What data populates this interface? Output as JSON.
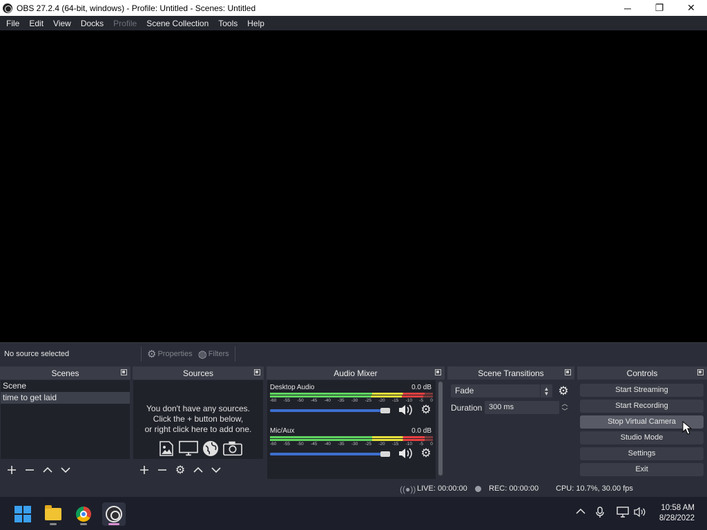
{
  "window": {
    "title": "OBS 27.2.4 (64-bit, windows) - Profile: Untitled - Scenes: Untitled",
    "minimize": "─",
    "maximize": "❐",
    "close": "✕"
  },
  "menu": [
    "File",
    "Edit",
    "View",
    "Docks",
    "Profile",
    "Scene Collection",
    "Tools",
    "Help"
  ],
  "context_bar": {
    "no_source": "No source selected",
    "properties": "Properties",
    "filters": "Filters"
  },
  "scenes": {
    "title": "Scenes",
    "items": [
      "Scene",
      "time to get laid"
    ],
    "selected_index": 1
  },
  "sources": {
    "title": "Sources",
    "empty_line1": "You don't have any sources.",
    "empty_line2": "Click the + button below,",
    "empty_line3": "or right click here to add one."
  },
  "audio_mixer": {
    "title": "Audio Mixer",
    "ticks": [
      "-60",
      "-55",
      "-50",
      "-45",
      "-40",
      "-35",
      "-30",
      "-25",
      "-20",
      "-15",
      "-10",
      "-5",
      "0"
    ],
    "channels": [
      {
        "name": "Desktop Audio",
        "db": "0.0 dB",
        "volume": 1.0
      },
      {
        "name": "Mic/Aux",
        "db": "0.0 dB",
        "volume": 1.0
      }
    ]
  },
  "scene_transitions": {
    "title": "Scene Transitions",
    "transition": "Fade",
    "duration_label": "Duration",
    "duration_value": "300 ms"
  },
  "controls": {
    "title": "Controls",
    "buttons": [
      "Start Streaming",
      "Start Recording",
      "Stop Virtual Camera",
      "Studio Mode",
      "Settings",
      "Exit"
    ]
  },
  "status": {
    "live": "LIVE: 00:00:00",
    "rec": "REC: 00:00:00",
    "cpu": "CPU: 10.7%, 30.00 fps"
  },
  "taskbar": {
    "time": "10:58 AM",
    "date": "8/28/2022"
  }
}
